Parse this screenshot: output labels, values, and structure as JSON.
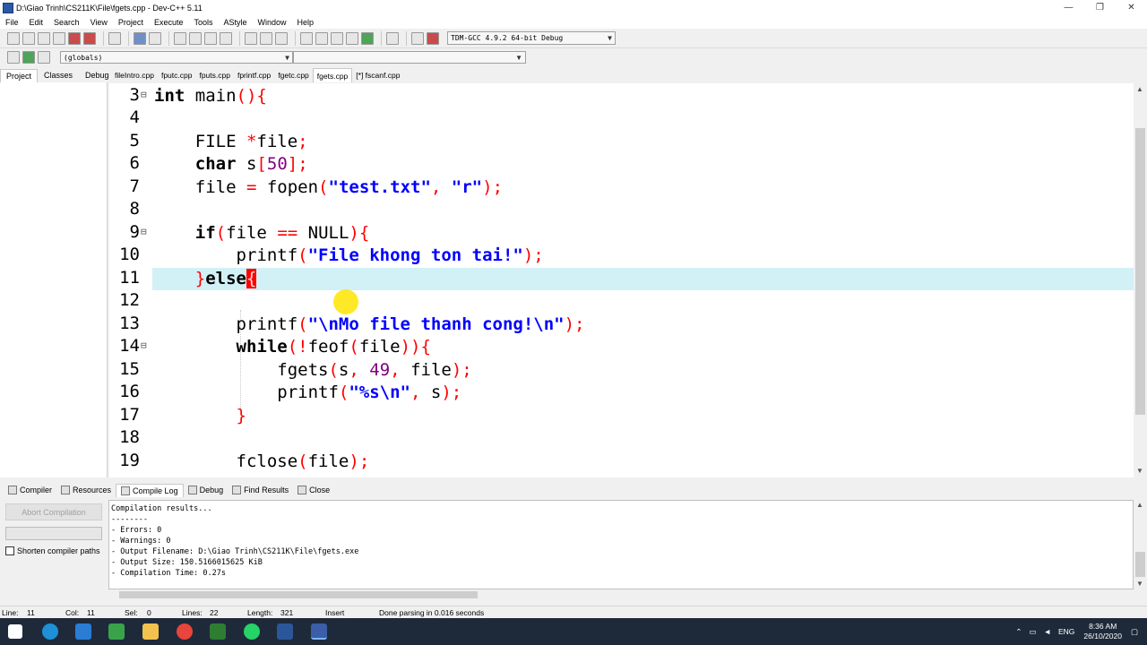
{
  "window": {
    "title": "D:\\Giao Trinh\\CS211K\\File\\fgets.cpp - Dev-C++ 5.11",
    "controls": [
      "—",
      "❐",
      "✕"
    ]
  },
  "menu": [
    "File",
    "Edit",
    "Search",
    "View",
    "Project",
    "Execute",
    "Tools",
    "AStyle",
    "Window",
    "Help"
  ],
  "toolbar": {
    "compiler": "TDM-GCC 4.9.2 64-bit Debug",
    "scope": "(globals)"
  },
  "project_tabs": [
    "Project",
    "Classes",
    "Debug"
  ],
  "file_tabs": [
    "fileIntro.cpp",
    "fputc.cpp",
    "fputs.cpp",
    "fprintf.cpp",
    "fgetc.cpp",
    "fgets.cpp",
    "[*] fscanf.cpp"
  ],
  "editor": {
    "line_numbers": [
      "3",
      "4",
      "5",
      "6",
      "7",
      "8",
      "9",
      "10",
      "11",
      "12",
      "13",
      "14",
      "15",
      "16",
      "17",
      "18",
      "19"
    ]
  },
  "bottom_tabs": [
    "Compiler",
    "Resources",
    "Compile Log",
    "Debug",
    "Find Results",
    "Close"
  ],
  "bottom_panel": {
    "abort_label": "Abort Compilation",
    "shorten_label": "Shorten compiler paths"
  },
  "compile_log": [
    "Compilation results...",
    "--------",
    "- Errors: 0",
    "- Warnings: 0",
    "- Output Filename: D:\\Giao Trinh\\CS211K\\File\\fgets.exe",
    "- Output Size: 150.5166015625 KiB",
    "- Compilation Time: 0.27s"
  ],
  "status": {
    "line": "Line:",
    "line_val": "11",
    "col": "Col:",
    "col_val": "11",
    "sel": "Sel:",
    "sel_val": "0",
    "lines": "Lines:",
    "lines_val": "22",
    "length": "Length:",
    "length_val": "321",
    "mode": "Insert",
    "message": "Done parsing in 0.016 seconds"
  },
  "taskbar": {
    "lang": "ENG",
    "time": "8:36 AM",
    "date": "26/10/2020"
  }
}
